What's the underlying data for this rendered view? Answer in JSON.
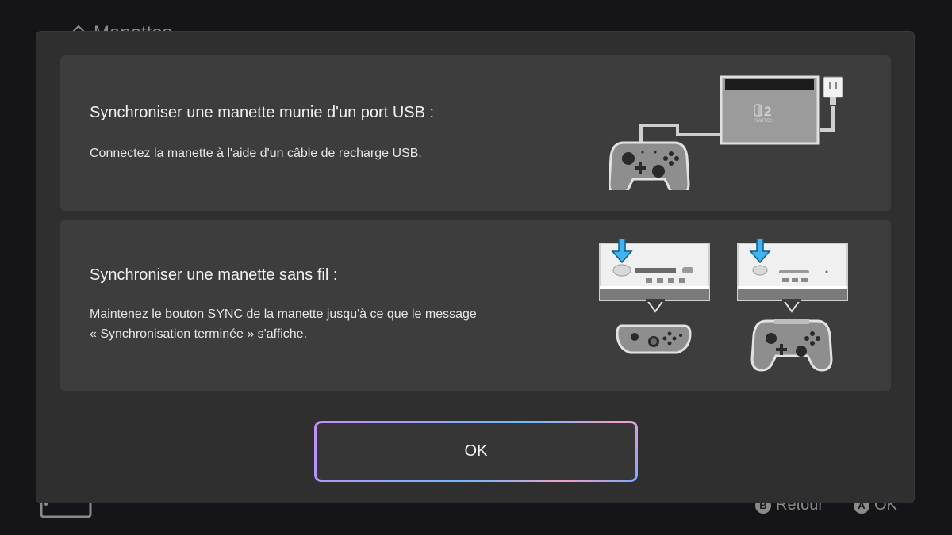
{
  "background": {
    "title": "Manettes",
    "footer": {
      "back_label": "Retour",
      "ok_label": "OK",
      "back_key": "B",
      "ok_key": "A"
    }
  },
  "dialog": {
    "usb_section": {
      "title": "Synchroniser une manette munie d'un port USB :",
      "description": "Connectez la manette à l'aide d'un câble de recharge USB.",
      "console_logo": "2",
      "console_label": "SWITCH"
    },
    "wireless_section": {
      "title": "Synchroniser une manette sans fil :",
      "description_line1": "Maintenez le bouton SYNC de la manette jusqu'à ce que le message",
      "description_line2": "« Synchronisation terminée » s'affiche."
    },
    "ok_button_label": "OK"
  },
  "colors": {
    "accent_arrow": "#3fb4f0",
    "card_bg": "#3d3d3d",
    "dialog_bg": "#2f2f2f"
  }
}
